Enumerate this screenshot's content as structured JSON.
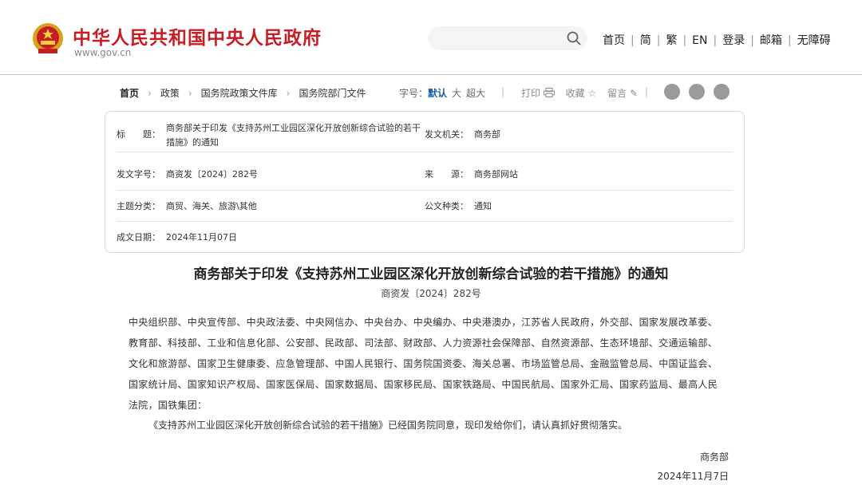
{
  "header": {
    "site_title": "中华人民共和国中央人民政府",
    "site_url": "www.gov.cn",
    "nav": [
      "首页",
      "简",
      "繁",
      "EN",
      "登录",
      "邮箱",
      "无障碍"
    ]
  },
  "breadcrumb": [
    "首页",
    "政策",
    "国务院政策文件库",
    "国务院部门文件"
  ],
  "fontsize": {
    "label": "字号：",
    "options": [
      "默认",
      "大",
      "超大"
    ]
  },
  "tools": {
    "print": "打印",
    "favorite": "收藏",
    "comment": "留言"
  },
  "info": {
    "title_label": "标　　题：",
    "title_value": "商务部关于印发《支持苏州工业园区深化开放创新综合试验的若干措施》的通知",
    "issuer_label": "发文机关：",
    "issuer_value": "商务部",
    "docno_label": "发文字号：",
    "docno_value": "商资发〔2024〕282号",
    "source_label": "来　　源：",
    "source_value": "商务部网站",
    "topic_label": "主题分类：",
    "topic_value": "商贸、海关、旅游\\其他",
    "type_label": "公文种类：",
    "type_value": "通知",
    "date_label": "成文日期：",
    "date_value": "2024年11月07日"
  },
  "document": {
    "title": "商务部关于印发《支持苏州工业园区深化开放创新综合试验的若干措施》的通知",
    "doc_no": "商资发〔2024〕282号",
    "recipients": "中央组织部、中央宣传部、中央政法委、中央网信办、中央台办、中央编办、中央港澳办，江苏省人民政府，外交部、国家发展改革委、教育部、科技部、工业和信息化部、公安部、民政部、司法部、财政部、人力资源社会保障部、自然资源部、生态环境部、交通运输部、文化和旅游部、国家卫生健康委、应急管理部、中国人民银行、国务院国资委、海关总署、市场监管总局、金融监管总局、中国证监会、国家统计局、国家知识产权局、国家医保局、国家数据局、国家移民局、国家铁路局、中国民航局、国家外汇局、国家药监局、最高人民法院，国铁集团：",
    "paragraph": "《支持苏州工业园区深化开放创新综合试验的若干措施》已经国务院同意，现印发给你们，请认真抓好贯彻落实。",
    "signature": "商务部",
    "date": "2024年11月7日"
  }
}
